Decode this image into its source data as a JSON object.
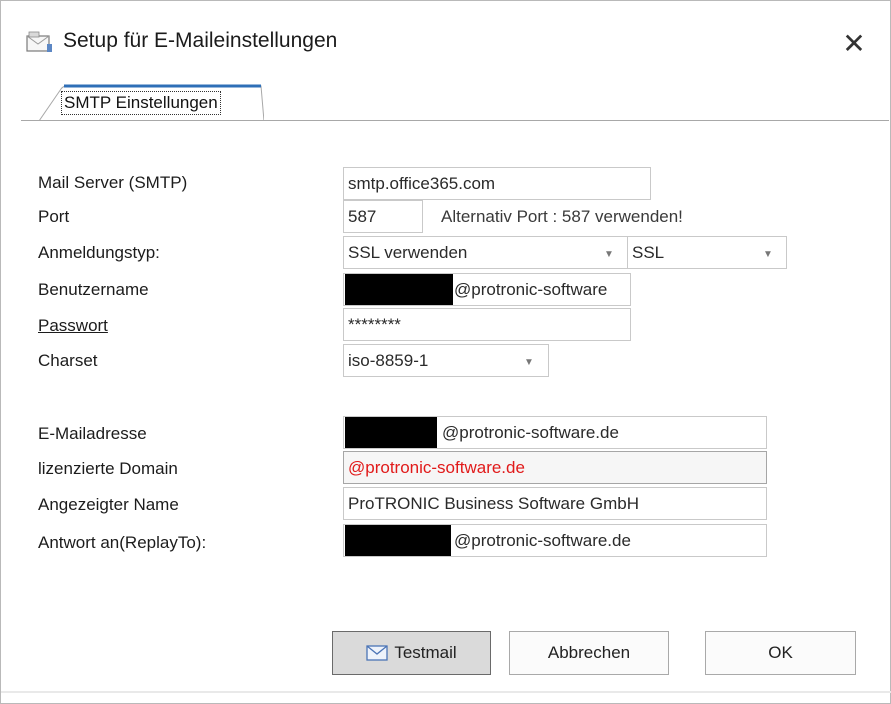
{
  "window": {
    "title": "Setup für E-Maileinstellungen",
    "close_icon": "close-icon",
    "app_icon": "mail-settings-icon"
  },
  "tab": {
    "label": "SMTP Einstellungen"
  },
  "form": {
    "smtp": {
      "label": "Mail Server (SMTP)",
      "value": "smtp.office365.com"
    },
    "port": {
      "label": "Port",
      "value": "587",
      "hint": "Alternativ Port : 587 verwenden!"
    },
    "auth": {
      "label": "Anmeldungstyp:",
      "value": "SSL verwenden",
      "secondary": "SSL"
    },
    "user": {
      "label": "Benutzername",
      "value": "@protronic-software"
    },
    "password": {
      "label": "Passwort",
      "value": "********"
    },
    "charset": {
      "label": "Charset",
      "value": "iso-8859-1"
    },
    "email": {
      "label": "E-Mailadresse",
      "value": "@protronic-software.de"
    },
    "domain": {
      "label": "lizenzierte Domain",
      "value": "@protronic-software.de",
      "color": "#e11a1a"
    },
    "display_name": {
      "label": "Angezeigter Name",
      "value": "ProTRONIC Business Software GmbH"
    },
    "reply_to": {
      "label": "Antwort an(ReplayTo):",
      "value": "@protronic-software.de"
    }
  },
  "buttons": {
    "testmail": "Testmail",
    "cancel": "Abbrechen",
    "ok": "OK"
  }
}
